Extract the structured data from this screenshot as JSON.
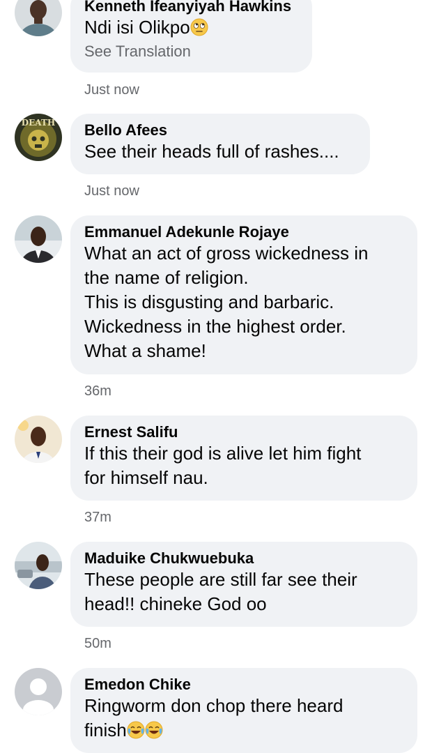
{
  "comments": [
    {
      "author": "Kenneth Ifeanyiyah Hawkins",
      "text": "Ndi isi Olikpo",
      "emoji": "face-with-rolling-eyes",
      "see_translation": "See Translation",
      "time": "Just now",
      "avatar": "person-photo"
    },
    {
      "author": "Bello Afees",
      "text": "See their heads full of rashes....",
      "time": "Just now",
      "avatar": "death-logo",
      "avatar_text": "DEATH"
    },
    {
      "author": "Emmanuel Adekunle Rojaye",
      "text": "What an act of gross wickedness in\nthe name of religion.\nThis is disgusting and barbaric.\nWickedness in the highest order.\nWhat a shame!",
      "time": "36m",
      "avatar": "person-photo"
    },
    {
      "author": "Ernest Salifu",
      "text": "If this their god is alive let him fight\nfor himself nau.",
      "time": "37m",
      "avatar": "person-photo"
    },
    {
      "author": "Maduike Chukwuebuka",
      "text": "These people are still far see their\nhead!! chineke God oo",
      "time": "50m",
      "avatar": "person-photo"
    },
    {
      "author": "Emedon Chike",
      "text": "Ringworm don chop there heard\nfinish",
      "emoji": "face-with-tears-of-joy",
      "emoji_count": 2,
      "time": "",
      "avatar": "default-silhouette"
    }
  ],
  "colors": {
    "bubble": "#f0f2f5",
    "text": "#050505",
    "secondary": "#65676b"
  }
}
